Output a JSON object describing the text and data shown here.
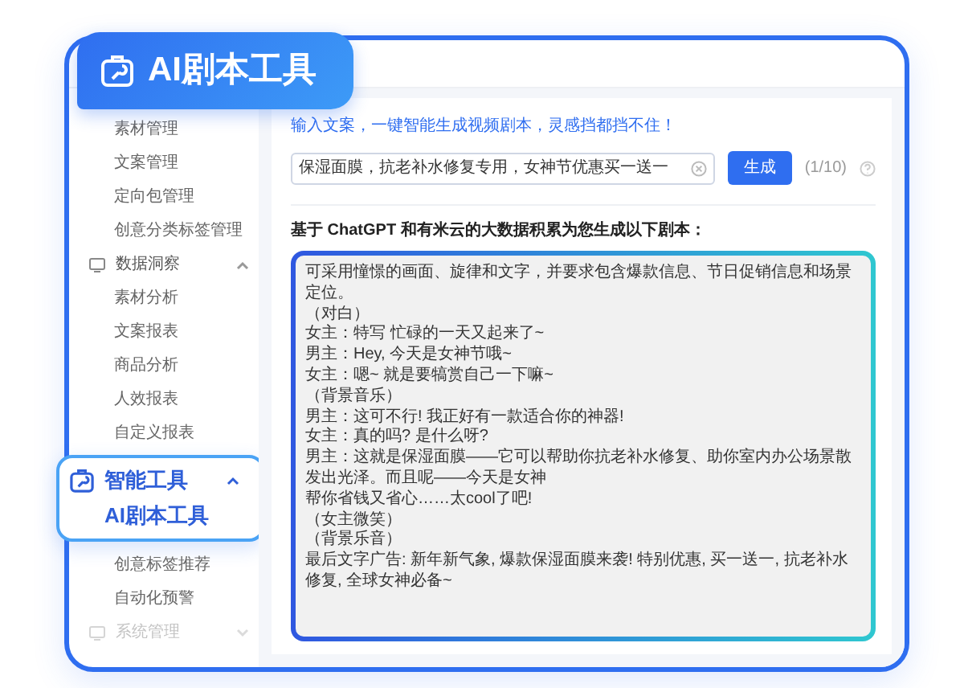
{
  "banner": {
    "title": "AI剧本工具"
  },
  "sidebar": {
    "items": [
      {
        "label": "素材管理",
        "kind": "item"
      },
      {
        "label": "文案管理",
        "kind": "item"
      },
      {
        "label": "定向包管理",
        "kind": "item"
      },
      {
        "label": "创意分类标签管理",
        "kind": "item"
      },
      {
        "label": "数据洞察",
        "kind": "group",
        "expanded": true
      },
      {
        "label": "素材分析",
        "kind": "item"
      },
      {
        "label": "文案报表",
        "kind": "item"
      },
      {
        "label": "商品分析",
        "kind": "item"
      },
      {
        "label": "人效报表",
        "kind": "item"
      },
      {
        "label": "自定义报表",
        "kind": "item"
      },
      {
        "label": "智能工具",
        "kind": "feature",
        "expanded": true,
        "children": [
          {
            "label": "AI剧本工具"
          }
        ]
      },
      {
        "label": "创意标签推荐",
        "kind": "item"
      },
      {
        "label": "自动化预警",
        "kind": "item"
      },
      {
        "label": "系统管理",
        "kind": "group",
        "expanded": false
      }
    ]
  },
  "main": {
    "prompt": "输入文案，一键智能生成视频剧本，灵感挡都挡不住！",
    "input": {
      "value": "保湿面膜，抗老补水修复专用，女神节优惠买一送一"
    },
    "generate_button": "生成",
    "usage": "(1/10)",
    "result_heading": "基于 ChatGPT 和有米云的大数据积累为您生成以下剧本：",
    "script_lines": [
      "可采用憧憬的画面、旋律和文字，并要求包含爆款信息、节日促销信息和场景定位。",
      "（对白）",
      "女主：特写 忙碌的一天又起来了~",
      "男主：Hey, 今天是女神节哦~",
      "女主：嗯~ 就是要犒赏自己一下嘛~",
      "（背景音乐）",
      "男主：这可不行! 我正好有一款适合你的神器!",
      "女主：真的吗? 是什么呀?",
      "男主：这就是保湿面膜——它可以帮助你抗老补水修复、助你室内办公场景散发出光泽。而且呢——今天是女神",
      "帮你省钱又省心……太cool了吧!",
      "（女主微笑）",
      "（背景乐音）",
      "最后文字广告: 新年新气象, 爆款保湿面膜来袭! 特别优惠, 买一送一, 抗老补水修复, 全球女神必备~"
    ]
  }
}
